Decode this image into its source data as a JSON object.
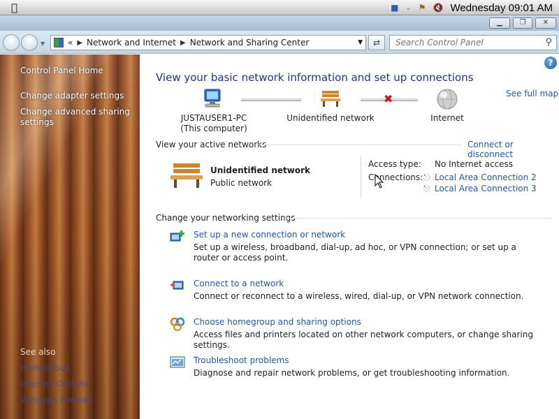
{
  "menubar": {
    "apple_icon": "apple-icon",
    "clock": "Wednesday 09:01 AM"
  },
  "window": {
    "minimize_icon": "minimize-icon",
    "maximize_icon": "maximize-icon",
    "close_icon": "close-icon"
  },
  "address": {
    "overflow": "«",
    "crumb1": "Network and Internet",
    "crumb2": "Network and Sharing Center",
    "search_placeholder": "Search Control Panel"
  },
  "sidebar": {
    "home": "Control Panel Home",
    "items": [
      {
        "label": "Change adapter settings"
      },
      {
        "label": "Change advanced sharing settings"
      }
    ],
    "see_also": "See also",
    "see_also_items": [
      {
        "label": "HomeGroup"
      },
      {
        "label": "Internet Options"
      },
      {
        "label": "Windows Firewall"
      }
    ]
  },
  "main": {
    "heading": "View your basic network information and set up connections",
    "see_full_map": "See full map",
    "map": {
      "computer_name": "JUSTAUSER1-PC",
      "computer_sub": "(This computer)",
      "network": "Unidentified network",
      "internet": "Internet"
    },
    "active_title": "View your active networks",
    "connect_disconnect": "Connect or disconnect",
    "active": {
      "name": "Unidentified network",
      "category": "Public network",
      "access_type_label": "Access type:",
      "access_type_value": "No Internet access",
      "connections_label": "Connections:",
      "connections": [
        "Local Area Connection 2",
        "Local Area Connection 3"
      ]
    },
    "change_title": "Change your networking settings",
    "tasks": [
      {
        "link": "Set up a new connection or network",
        "desc": "Set up a wireless, broadband, dial-up, ad hoc, or VPN connection; or set up a router or access point."
      },
      {
        "link": "Connect to a network",
        "desc": "Connect or reconnect to a wireless, wired, dial-up, or VPN network connection."
      },
      {
        "link": "Choose homegroup and sharing options",
        "desc": "Access files and printers located on other network computers, or change sharing settings."
      },
      {
        "link": "Troubleshoot problems",
        "desc": "Diagnose and repair network problems, or get troubleshooting information."
      }
    ]
  }
}
